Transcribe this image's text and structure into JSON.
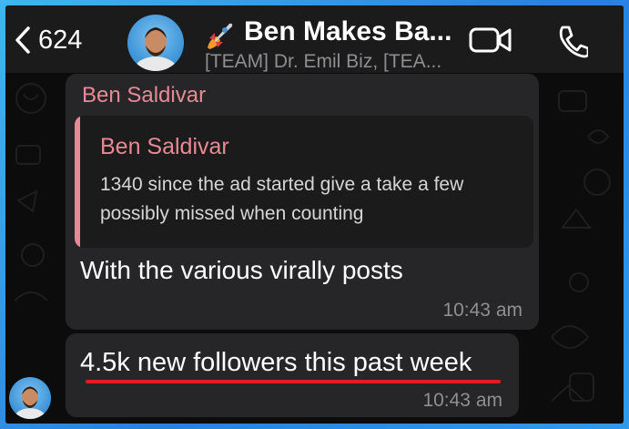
{
  "header": {
    "back_count": "624",
    "title": "Ben Makes Ba...",
    "subtitle": "[TEAM] Dr. Emil Biz, [TEA..."
  },
  "icons": {
    "back": "chevron-left-icon",
    "title_emoji": "rocket-icon",
    "video": "video-camera-icon",
    "call": "phone-icon"
  },
  "messages": [
    {
      "sender": "Ben Saldivar",
      "quote": {
        "sender": "Ben Saldivar",
        "text": "1340 since the ad started give a take a few possibly missed when counting"
      },
      "text": "With the various virally posts",
      "time": "10:43 am"
    },
    {
      "text": "4.5k new followers this past week",
      "time": "10:43 am",
      "highlight_color": "#e31b23"
    }
  ],
  "colors": {
    "sender_name": "#e88a95",
    "bubble": "#262628",
    "header_bg": "#1b1b1b",
    "frame_border": "#3fb6ef"
  }
}
